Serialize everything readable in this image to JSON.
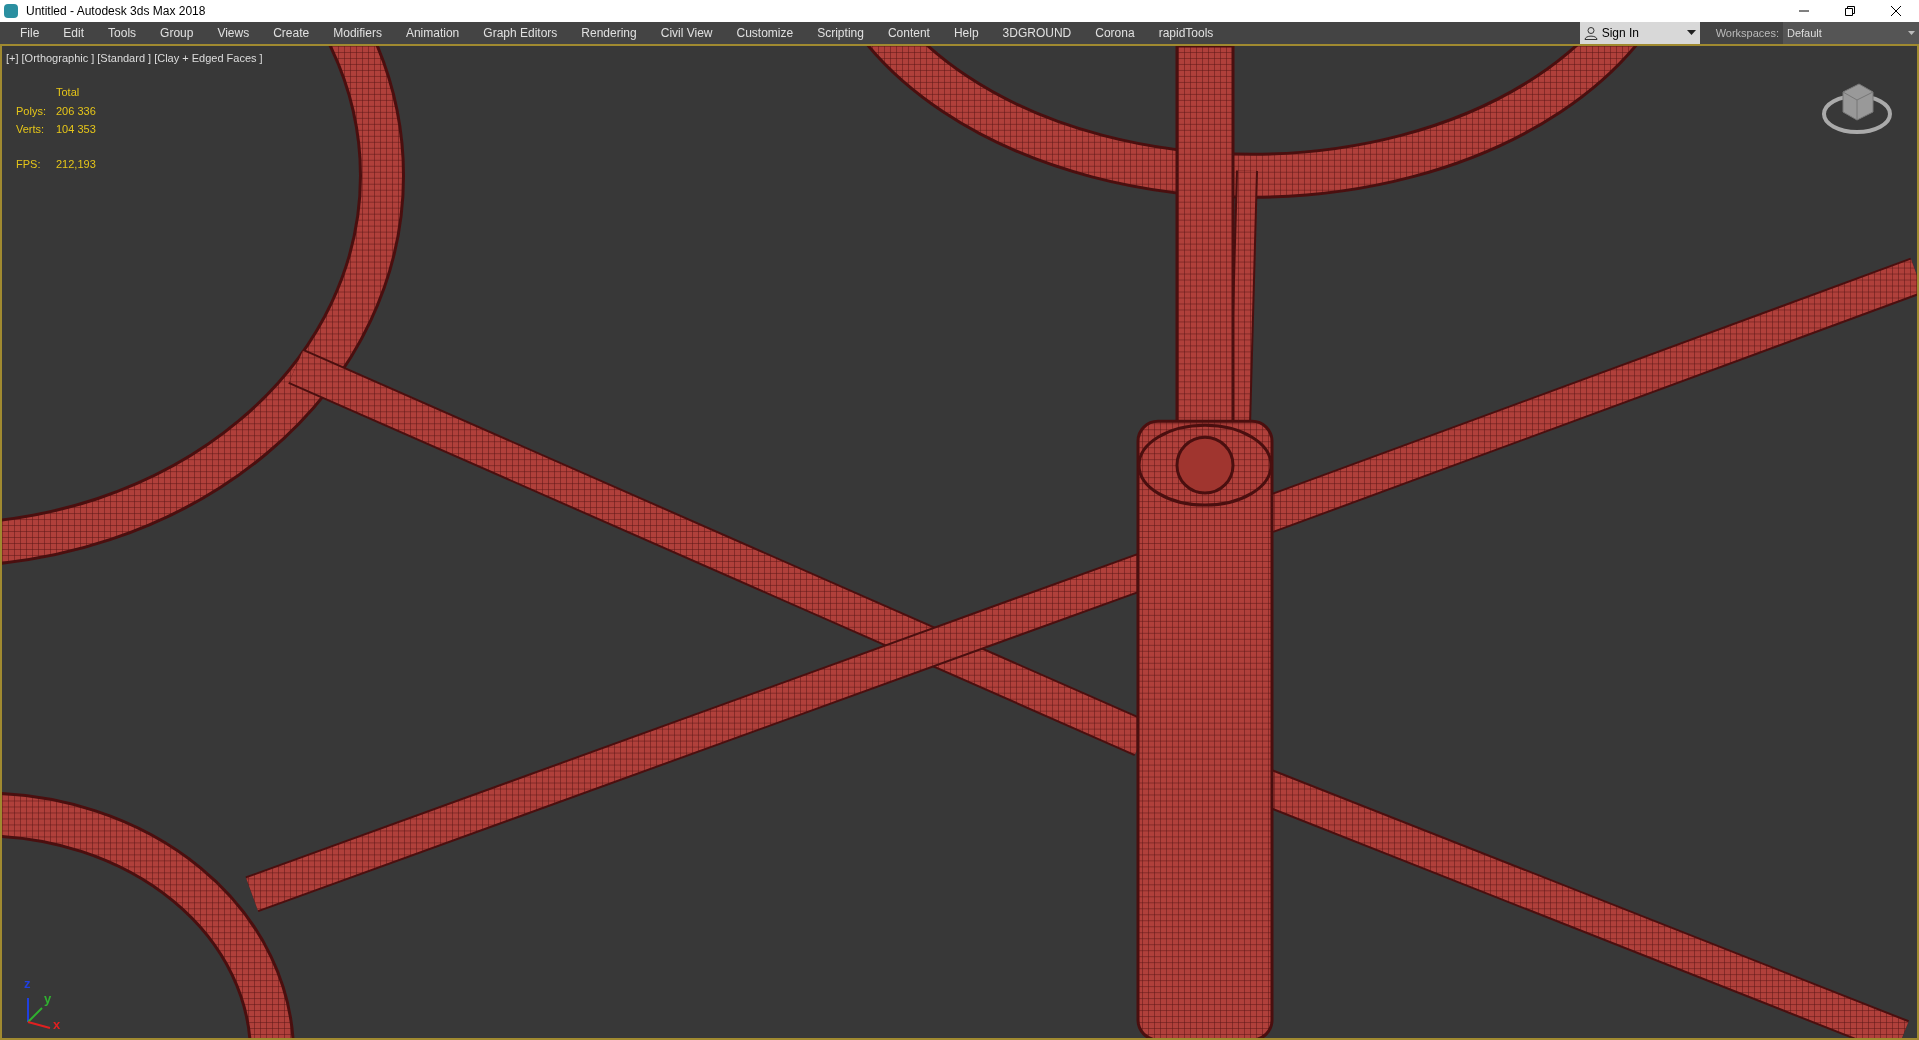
{
  "window": {
    "title": "Untitled - Autodesk 3ds Max 2018"
  },
  "menu": [
    "File",
    "Edit",
    "Tools",
    "Group",
    "Views",
    "Create",
    "Modifiers",
    "Animation",
    "Graph Editors",
    "Rendering",
    "Civil View",
    "Customize",
    "Scripting",
    "Content",
    "Help",
    "3DGROUND",
    "Corona",
    "rapidTools"
  ],
  "account": {
    "label": "Sign In"
  },
  "workspaces": {
    "label": "Workspaces:",
    "value": "Default"
  },
  "viewport": {
    "labels": [
      "[+]",
      "[Orthographic ]",
      "[Standard ]",
      "[Clay + Edged Faces ]"
    ],
    "stats": {
      "header": "Total",
      "rows": [
        {
          "label": "Polys:",
          "value": "206 336"
        },
        {
          "label": "Verts:",
          "value": "104 353"
        }
      ],
      "fps": {
        "label": "FPS:",
        "value": "212,193"
      }
    },
    "axes": [
      {
        "label": "z",
        "color": "#2040e0"
      },
      {
        "label": "y",
        "color": "#30b030"
      },
      {
        "label": "x",
        "color": "#e02020"
      }
    ]
  }
}
